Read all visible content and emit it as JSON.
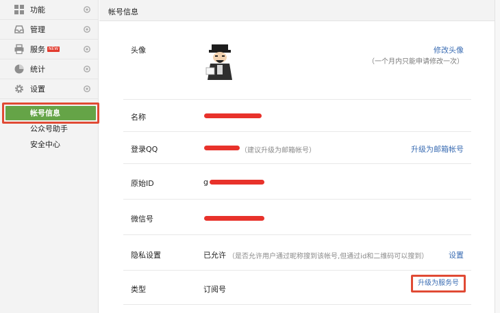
{
  "sidebar": {
    "groups": [
      {
        "label": "功能",
        "icon": "grid-icon"
      },
      {
        "label": "管理",
        "icon": "inbox-icon"
      },
      {
        "label": "服务",
        "icon": "printer-icon",
        "badge": "NEW"
      },
      {
        "label": "统计",
        "icon": "pie-chart-icon"
      },
      {
        "label": "设置",
        "icon": "gear-icon"
      }
    ],
    "settings_items": [
      {
        "label": "帐号信息"
      },
      {
        "label": "公众号助手"
      },
      {
        "label": "安全中心"
      }
    ]
  },
  "main": {
    "title": "帐号信息",
    "rows": {
      "avatar": {
        "label": "头像",
        "action": "修改头像",
        "note": "（一个月内只能申请修改一次）"
      },
      "name": {
        "label": "名称"
      },
      "login_qq": {
        "label": "登录QQ",
        "note": "（建议升级为邮箱帐号）",
        "action": "升级为邮箱帐号"
      },
      "original_id": {
        "label": "原始ID",
        "value_prefix": "g"
      },
      "wechat_id": {
        "label": "微信号"
      },
      "privacy": {
        "label": "隐私设置",
        "value": "已允许",
        "note": "（是否允许用户通过昵称搜到该帐号,但通过id和二维码可以搜到）",
        "action": "设置"
      },
      "type": {
        "label": "类型",
        "value": "订阅号",
        "action": "升级为服务号"
      }
    }
  },
  "colors": {
    "accent_green": "#65a447",
    "highlight_red": "#e04a34",
    "link_blue": "#3b6db3",
    "redaction_red": "#e8322b"
  }
}
